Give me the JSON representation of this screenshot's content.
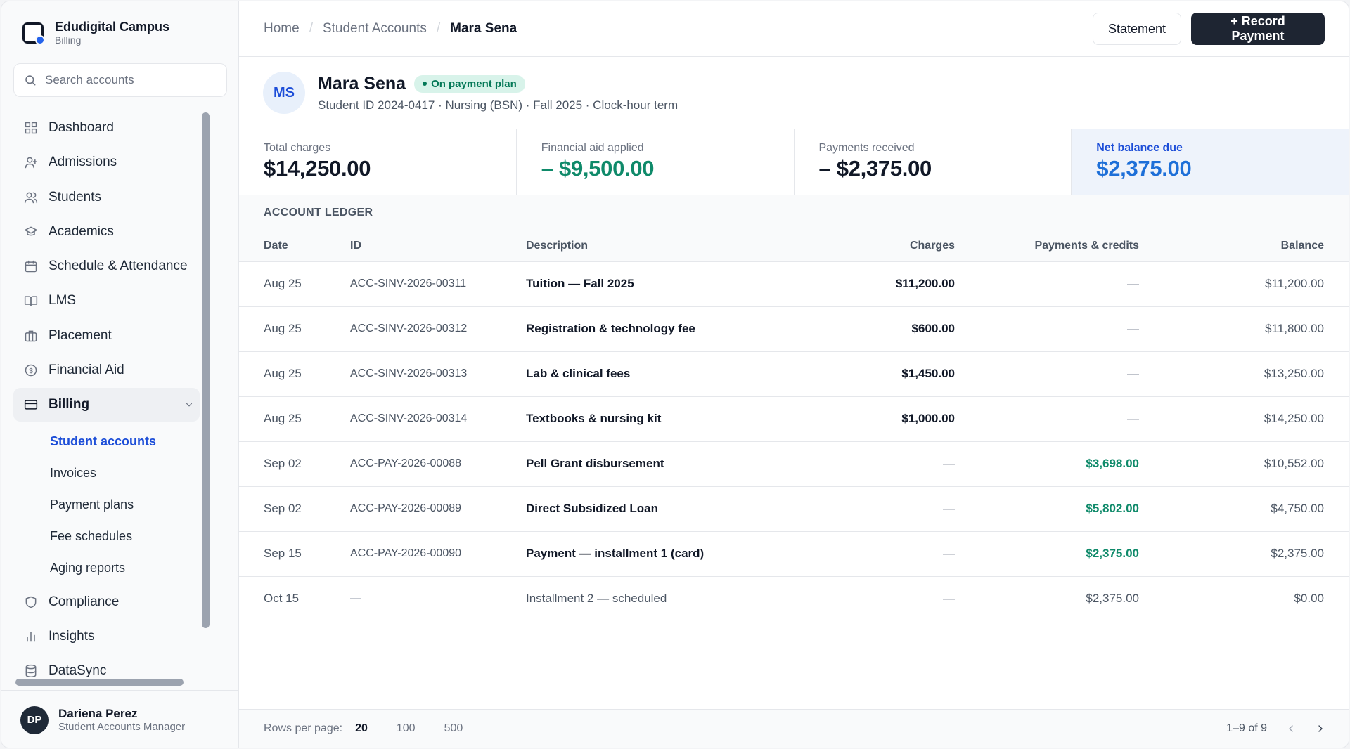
{
  "brand": {
    "name": "Edudigital Campus",
    "module": "Billing"
  },
  "search": {
    "placeholder": "Search accounts"
  },
  "nav": {
    "items": [
      {
        "label": "Dashboard",
        "icon": "grid-icon"
      },
      {
        "label": "Admissions",
        "icon": "user-plus-icon"
      },
      {
        "label": "Students",
        "icon": "users-icon"
      },
      {
        "label": "Academics",
        "icon": "graduation-cap-icon"
      },
      {
        "label": "Schedule & Attendance",
        "icon": "calendar-icon"
      },
      {
        "label": "LMS",
        "icon": "book-icon"
      },
      {
        "label": "Placement",
        "icon": "briefcase-icon"
      },
      {
        "label": "Financial Aid",
        "icon": "dollar-circle-icon"
      },
      {
        "label": "Billing",
        "icon": "credit-card-icon",
        "active": true
      }
    ],
    "billing_sub": [
      {
        "label": "Student accounts",
        "active": true
      },
      {
        "label": "Invoices"
      },
      {
        "label": "Payment plans"
      },
      {
        "label": "Fee schedules"
      },
      {
        "label": "Aging reports"
      }
    ],
    "after": [
      {
        "label": "Compliance",
        "icon": "shield-icon"
      },
      {
        "label": "Insights",
        "icon": "bar-chart-icon"
      },
      {
        "label": "DataSync",
        "icon": "database-icon"
      }
    ]
  },
  "user": {
    "initials": "DP",
    "name": "Dariena Perez",
    "role": "Student Accounts Manager"
  },
  "breadcrumb": {
    "home": "Home",
    "section": "Student Accounts",
    "current": "Mara Sena"
  },
  "actions": {
    "statement": "Statement",
    "record_payment": "+ Record Payment"
  },
  "student": {
    "initials": "MS",
    "name": "Mara Sena",
    "status": "On payment plan",
    "meta": "Student ID 2024-0417 · Nursing (BSN) · Fall 2025 · Clock-hour term"
  },
  "stats": {
    "total_charges": {
      "label": "Total charges",
      "value": "$14,250.00"
    },
    "financial_aid": {
      "label": "Financial aid applied",
      "value": "– $9,500.00"
    },
    "payments": {
      "label": "Payments received",
      "value": "– $2,375.00"
    },
    "net_balance": {
      "label": "Net balance due",
      "value": "$2,375.00"
    }
  },
  "ledger": {
    "title": "ACCOUNT LEDGER",
    "columns": {
      "date": "Date",
      "id": "ID",
      "description": "Description",
      "charges": "Charges",
      "payments": "Payments & credits",
      "balance": "Balance"
    },
    "rows": [
      {
        "date": "Aug 25",
        "id": "ACC-SINV-2026-00311",
        "description": "Tuition — Fall 2025",
        "charges": "$11,200.00",
        "payments": "—",
        "balance": "$11,200.00"
      },
      {
        "date": "Aug 25",
        "id": "ACC-SINV-2026-00312",
        "description": "Registration & technology fee",
        "charges": "$600.00",
        "payments": "—",
        "balance": "$11,800.00"
      },
      {
        "date": "Aug 25",
        "id": "ACC-SINV-2026-00313",
        "description": "Lab & clinical fees",
        "charges": "$1,450.00",
        "payments": "—",
        "balance": "$13,250.00"
      },
      {
        "date": "Aug 25",
        "id": "ACC-SINV-2026-00314",
        "description": "Textbooks & nursing kit",
        "charges": "$1,000.00",
        "payments": "—",
        "balance": "$14,250.00"
      },
      {
        "date": "Sep 02",
        "id": "ACC-PAY-2026-00088",
        "description": "Pell Grant disbursement",
        "charges": "—",
        "payments": "$3,698.00",
        "balance": "$10,552.00"
      },
      {
        "date": "Sep 02",
        "id": "ACC-PAY-2026-00089",
        "description": "Direct Subsidized Loan",
        "charges": "—",
        "payments": "$5,802.00",
        "balance": "$4,750.00"
      },
      {
        "date": "Sep 15",
        "id": "ACC-PAY-2026-00090",
        "description": "Payment — installment 1 (card)",
        "charges": "—",
        "payments": "$2,375.00",
        "balance": "$2,375.00"
      },
      {
        "date": "Oct 15",
        "id": "—",
        "description": "Installment 2 — scheduled",
        "charges": "—",
        "payments": "$2,375.00",
        "balance": "$0.00"
      }
    ]
  },
  "footer": {
    "rows_per_page_label": "Rows per page:",
    "options": [
      "20",
      "100",
      "500"
    ],
    "range": "1–9 of 9"
  },
  "colors": {
    "accent": "#1d4ed8",
    "credit_green": "#0f8a6a",
    "primary_button": "#1e2532"
  }
}
